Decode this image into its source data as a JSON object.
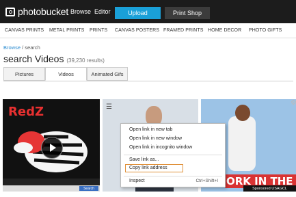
{
  "header": {
    "logo_text": "photobucket",
    "nav": [
      "Browse",
      "Editor"
    ],
    "upload_label": "Upload",
    "printshop_label": "Print Shop"
  },
  "categories": [
    "CANVAS PRINTS",
    "METAL PRINTS",
    "PRINTS",
    "CANVAS POSTERS",
    "FRAMED PRINTS",
    "HOME DECOR",
    "PHOTO GIFTS"
  ],
  "breadcrumb": {
    "link": "Browse",
    "separator": "/",
    "current": "search"
  },
  "title": {
    "text": "search Videos",
    "count": "(39,230 results)"
  },
  "tabs": [
    {
      "label": "Pictures",
      "active": false
    },
    {
      "label": "Videos",
      "active": true
    },
    {
      "label": "Animated Gifs",
      "active": false
    }
  ],
  "thumbs": {
    "first_text": "RedZ",
    "search_button": "Search",
    "banner_text": "ORK IN THE",
    "sponsored_text": "Sponsored USAGCL"
  },
  "context_menu": {
    "items": [
      "Open link in new tab",
      "Open link in new window",
      "Open link in incognito window",
      "Save link as...",
      "Copy link address",
      "Inspect"
    ],
    "highlighted": "Copy link address",
    "inspect_shortcut": "Ctrl+Shift+I"
  }
}
